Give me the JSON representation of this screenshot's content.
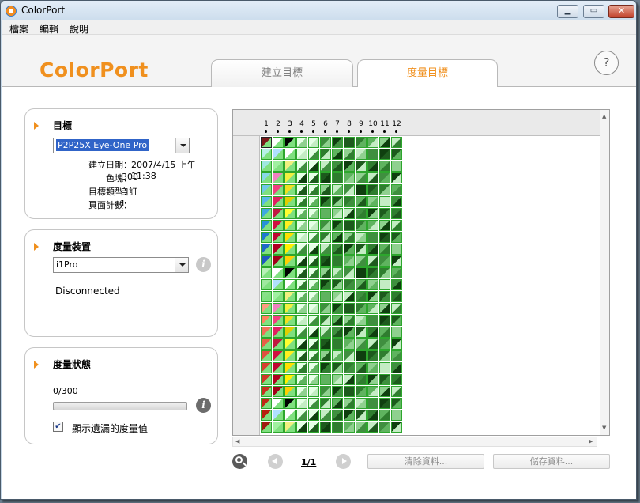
{
  "window": {
    "title": "ColorPort"
  },
  "menu": [
    "檔案",
    "編輯",
    "說明"
  ],
  "header": {
    "logo": "ColorPort",
    "tabs": [
      {
        "label": "建立目標",
        "active": false
      },
      {
        "label": "度量目標",
        "active": true
      }
    ],
    "help": "?"
  },
  "target": {
    "title": "目標",
    "selected": "P2P25X Eye-One Pro",
    "fields": [
      {
        "label": "建立日期：",
        "value": "2007/4/15 上午 11:38"
      },
      {
        "label": "色塊：",
        "value": "300"
      },
      {
        "label": "目標類型：",
        "value": "自訂"
      },
      {
        "label": "頁面計數：",
        "value": "1"
      }
    ]
  },
  "device": {
    "title": "度量裝置",
    "selected": "i1Pro",
    "status": "Disconnected"
  },
  "measure": {
    "title": "度量狀態",
    "count": "0/300",
    "progress": 0,
    "checkbox_label": "顯示遺漏的度量值",
    "checked": true
  },
  "grid": {
    "columns": [
      "1",
      "2",
      "3",
      "4",
      "5",
      "6",
      "7",
      "8",
      "9",
      "10",
      "11",
      "12"
    ],
    "rows": 25
  },
  "pager": {
    "page": "1/1"
  },
  "actions": {
    "clear": "清除資料...",
    "save": "儲存資料..."
  },
  "colors": {
    "accent": "#f0901e",
    "patch_border": "#2da62d"
  }
}
